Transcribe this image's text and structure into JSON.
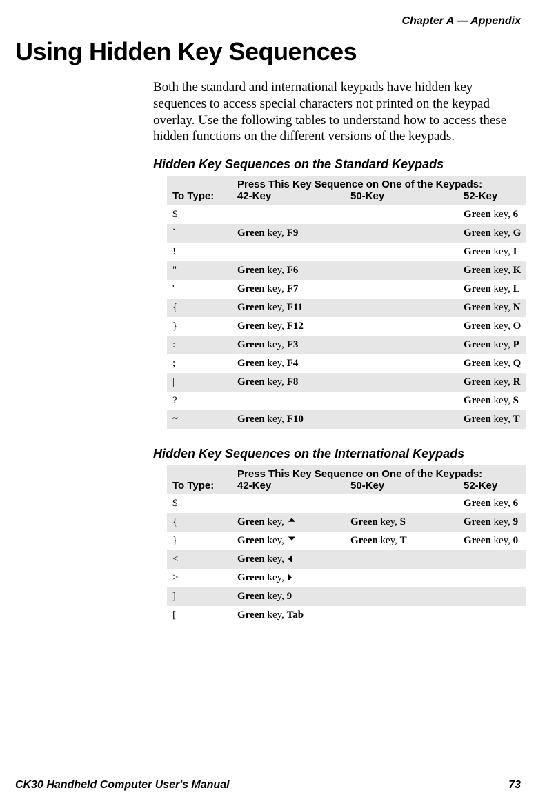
{
  "header": {
    "chapter": "Chapter A — Appendix"
  },
  "section": {
    "title": "Using Hidden Key Sequences",
    "intro": "Both the standard and international keypads have hidden key sequences to access special characters not printed on the keypad overlay. Use the following tables to understand how to access these hidden functions on the different versions of the keypads."
  },
  "tables": {
    "standard": {
      "title": "Hidden Key Sequences on the Standard Keypads",
      "header_span": "Press This Key Sequence on One of the Keypads:",
      "cols": {
        "to_type": "To Type:",
        "c42": "42-Key",
        "c50": "50-Key",
        "c52": "52-Key"
      },
      "rows": [
        {
          "char": "$",
          "c42": "",
          "c50": "",
          "c52g": "Green",
          "c52t": " key, ",
          "c52b": "6"
        },
        {
          "char": "`",
          "c42g": "Green",
          "c42t": " key, ",
          "c42b": "F9",
          "c50": "",
          "c52g": "Green",
          "c52t": " key, ",
          "c52b": "G",
          "shade": true
        },
        {
          "char": "!",
          "c42": "",
          "c50": "",
          "c52g": "Green",
          "c52t": " key, ",
          "c52b": "I"
        },
        {
          "char": "\"",
          "c42g": "Green",
          "c42t": " key, ",
          "c42b": "F6",
          "c50": "",
          "c52g": "Green",
          "c52t": " key, ",
          "c52b": "K",
          "shade": true
        },
        {
          "char": "'",
          "c42g": "Green",
          "c42t": " key, ",
          "c42b": "F7",
          "c50": "",
          "c52g": "Green",
          "c52t": " key, ",
          "c52b": "L"
        },
        {
          "char": "{",
          "c42g": "Green",
          "c42t": " key, ",
          "c42b": "F11",
          "c50": "",
          "c52g": "Green",
          "c52t": " key, ",
          "c52b": "N",
          "shade": true
        },
        {
          "char": "}",
          "c42g": "Green",
          "c42t": " key, ",
          "c42b": "F12",
          "c50": "",
          "c52g": "Green",
          "c52t": " key, ",
          "c52b": "O"
        },
        {
          "char": ":",
          "c42g": "Green",
          "c42t": " key, ",
          "c42b": "F3",
          "c50": "",
          "c52g": "Green",
          "c52t": " key, ",
          "c52b": "P",
          "shade": true
        },
        {
          "char": ";",
          "c42g": "Green",
          "c42t": " key, ",
          "c42b": "F4",
          "c50": "",
          "c52g": "Green",
          "c52t": " key, ",
          "c52b": "Q"
        },
        {
          "char": "|",
          "c42g": "Green",
          "c42t": " key, ",
          "c42b": "F8",
          "c50": "",
          "c52g": "Green",
          "c52t": " key, ",
          "c52b": "R",
          "shade": true
        },
        {
          "char": "?",
          "c42": "",
          "c50": "",
          "c52g": "Green",
          "c52t": " key, ",
          "c52b": "S"
        },
        {
          "char": "~",
          "c42g": "Green",
          "c42t": " key, ",
          "c42b": "F10",
          "c50": "",
          "c52g": "Green",
          "c52t": " key, ",
          "c52b": "T",
          "shade": true
        }
      ]
    },
    "international": {
      "title": "Hidden Key Sequences on the International Keypads",
      "header_span": "Press This Key Sequence on One of the Keypads:",
      "cols": {
        "to_type": "To Type:",
        "c42": "42-Key",
        "c50": "50-Key",
        "c52": "52-Key"
      },
      "rows": [
        {
          "char": "$",
          "c42": "",
          "c50": "",
          "c52g": "Green",
          "c52t": " key, ",
          "c52b": "6"
        },
        {
          "char": "{",
          "c42g": "Green",
          "c42t": " key, ",
          "c42icon": "up",
          "c50g": "Green",
          "c50t": " key, ",
          "c50b": "S",
          "c52g": "Green",
          "c52t": " key, ",
          "c52b": "9",
          "shade": true
        },
        {
          "char": "}",
          "c42g": "Green",
          "c42t": " key, ",
          "c42icon": "down",
          "c50g": "Green",
          "c50t": " key, ",
          "c50b": "T",
          "c52g": "Green",
          "c52t": " key, ",
          "c52b": "0"
        },
        {
          "char": "<",
          "c42g": "Green",
          "c42t": " key, ",
          "c42icon": "left",
          "c50": "",
          "c52": "",
          "shade": true
        },
        {
          "char": ">",
          "c42g": "Green",
          "c42t": " key, ",
          "c42icon": "right",
          "c50": "",
          "c52": ""
        },
        {
          "char": "]",
          "c42g": "Green",
          "c42t": " key, ",
          "c42b": "9",
          "c50": "",
          "c52": "",
          "shade": true
        },
        {
          "char": "[",
          "c42g": "Green",
          "c42t": " key, ",
          "c42b": "Tab",
          "c50": "",
          "c52": ""
        }
      ]
    }
  },
  "icons": {
    "up": "arrow-up-icon",
    "down": "arrow-down-icon",
    "left": "arrow-left-icon",
    "right": "arrow-right-icon"
  },
  "footer": {
    "manual": "CK30 Handheld Computer User's Manual",
    "page": "73"
  }
}
